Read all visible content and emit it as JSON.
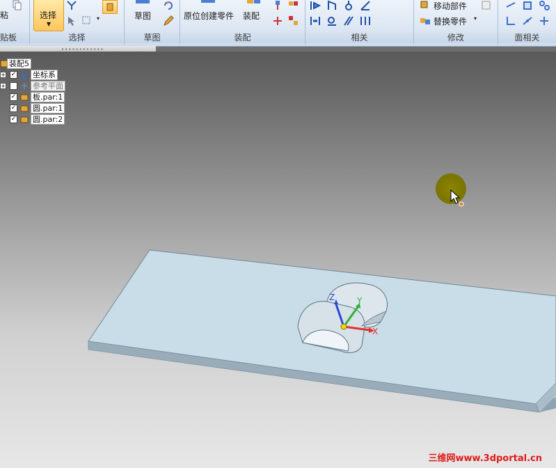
{
  "ribbon": {
    "groups": [
      {
        "id": "clipboard",
        "label": "贴板"
      },
      {
        "id": "select",
        "label": "选择"
      },
      {
        "id": "sketch",
        "label": "草图"
      },
      {
        "id": "assemble",
        "label": "装配"
      },
      {
        "id": "relate",
        "label": "相关"
      },
      {
        "id": "modify",
        "label": "修改"
      },
      {
        "id": "face",
        "label": "面相关"
      }
    ],
    "clipboard_fragment": "粘",
    "select_button": "选择",
    "sketch_button": "草图",
    "create_in_place": "原位创建零件",
    "assemble_button": "装配",
    "move_part": "移动部件",
    "replace_part": "替换零件"
  },
  "tree": {
    "root": "装配5",
    "items": [
      {
        "label": "坐标系",
        "checked": true,
        "expander": "+"
      },
      {
        "label": "参考平面",
        "checked": false,
        "expander": "+"
      },
      {
        "label": "板.par:1",
        "checked": true,
        "expander": ""
      },
      {
        "label": "圆.par:1",
        "checked": true,
        "expander": ""
      },
      {
        "label": "圆.par:2",
        "checked": true,
        "expander": ""
      }
    ]
  },
  "triad": {
    "x": "X",
    "y": "Y",
    "z": "Z"
  },
  "colors": {
    "accent": "#ffc65c",
    "cursor_halo": "#8c8500",
    "plate_top": "#c9dde8",
    "axis_x": "#e53030",
    "axis_y": "#2fb03a",
    "axis_z": "#2747d6",
    "watermark": "#e01818"
  },
  "watermark": "三维网www.3dportal.cn"
}
